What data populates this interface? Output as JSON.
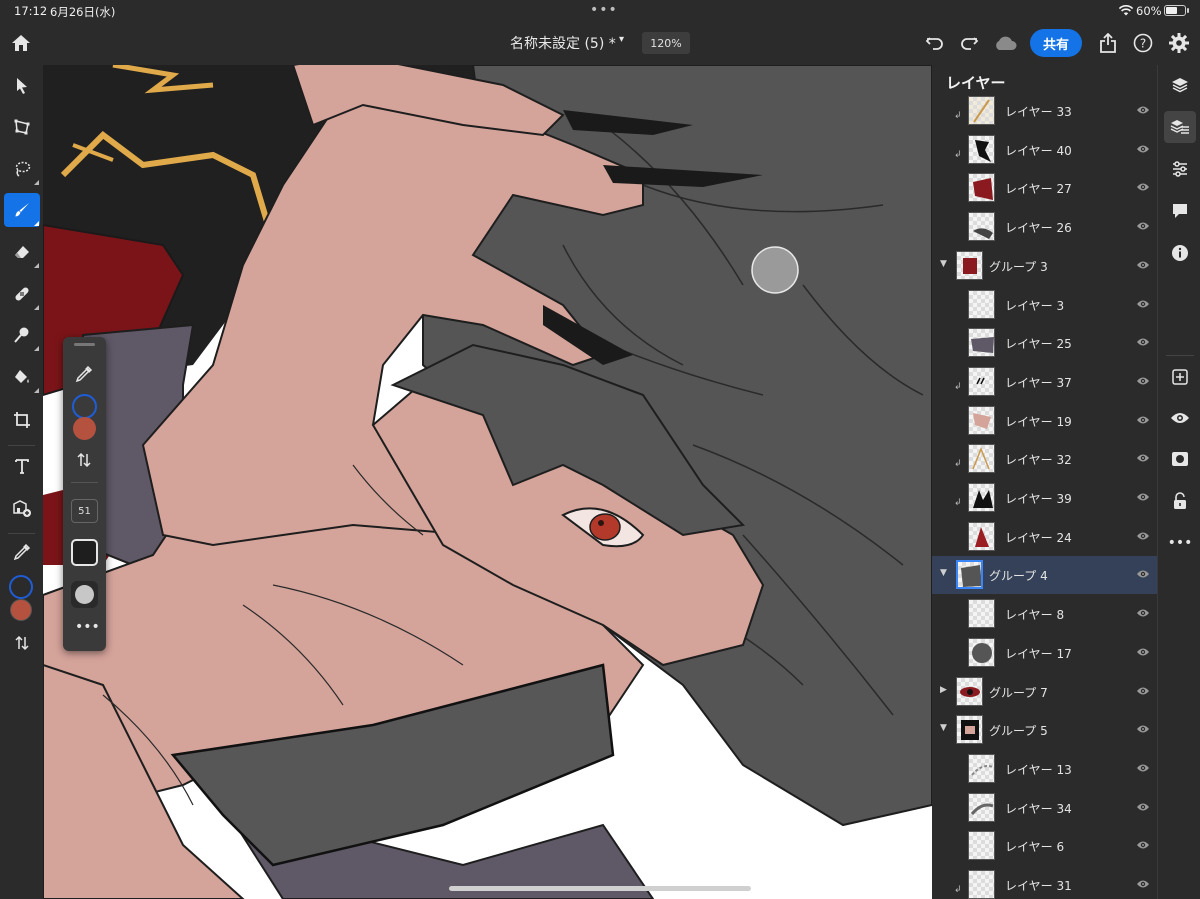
{
  "status_bar": {
    "time": "17:12",
    "date": "6月26日(水)",
    "battery": "60%"
  },
  "header": {
    "doc_title": "名称未設定 (5) *",
    "zoom": "120%",
    "share_label": "共有",
    "icons": [
      "home-icon",
      "undo-icon",
      "redo-icon",
      "cloud-icon",
      "share-upload-icon",
      "help-icon",
      "settings-icon"
    ]
  },
  "left_toolbar": {
    "tools": [
      "select-tool",
      "transform-tool",
      "lasso-tool",
      "brush-tool",
      "eraser-tool",
      "heal-tool",
      "smudge-tool",
      "fill-tool",
      "crop-tool",
      "type-tool",
      "place-image-tool",
      "eyedropper-tool"
    ],
    "active": "brush-tool",
    "foreground_color": "#1f5dd6",
    "background_color": "#b4513f"
  },
  "brush_panel": {
    "size": "51"
  },
  "layers_panel": {
    "title": "レイヤー",
    "items": [
      {
        "name": "レイヤー 33",
        "kind": "layer",
        "clipped": true
      },
      {
        "name": "レイヤー 40",
        "kind": "layer",
        "clipped": true
      },
      {
        "name": "レイヤー 27",
        "kind": "layer",
        "clipped": false
      },
      {
        "name": "レイヤー 26",
        "kind": "layer",
        "clipped": false
      },
      {
        "name": "グループ 3",
        "kind": "group",
        "expanded": true
      },
      {
        "name": "レイヤー 3",
        "kind": "layer",
        "clipped": false
      },
      {
        "name": "レイヤー 25",
        "kind": "layer",
        "clipped": false
      },
      {
        "name": "レイヤー 37",
        "kind": "layer",
        "clipped": true
      },
      {
        "name": "レイヤー 19",
        "kind": "layer",
        "clipped": false
      },
      {
        "name": "レイヤー 32",
        "kind": "layer",
        "clipped": true
      },
      {
        "name": "レイヤー 39",
        "kind": "layer",
        "clipped": true
      },
      {
        "name": "レイヤー 24",
        "kind": "layer",
        "clipped": false
      },
      {
        "name": "グループ 4",
        "kind": "group",
        "expanded": true,
        "selected": true
      },
      {
        "name": "レイヤー 8",
        "kind": "layer",
        "clipped": false
      },
      {
        "name": "レイヤー 17",
        "kind": "layer",
        "clipped": false
      },
      {
        "name": "グループ 7",
        "kind": "group",
        "expanded": false
      },
      {
        "name": "グループ 5",
        "kind": "group",
        "expanded": true
      },
      {
        "name": "レイヤー 13",
        "kind": "layer",
        "clipped": false
      },
      {
        "name": "レイヤー 34",
        "kind": "layer",
        "clipped": false
      },
      {
        "name": "レイヤー 6",
        "kind": "layer",
        "clipped": false
      },
      {
        "name": "レイヤー 31",
        "kind": "layer",
        "clipped": true
      }
    ]
  },
  "right_rail": {
    "icons": [
      "layers-icon",
      "layer-properties-icon",
      "adjustments-icon",
      "comments-icon",
      "info-icon",
      "add-layer-icon",
      "visibility-icon",
      "mask-icon",
      "lock-icon",
      "more-icon"
    ],
    "active": "layer-properties-icon"
  },
  "colors": {
    "accent": "#1473e6",
    "selection": "#344158"
  }
}
